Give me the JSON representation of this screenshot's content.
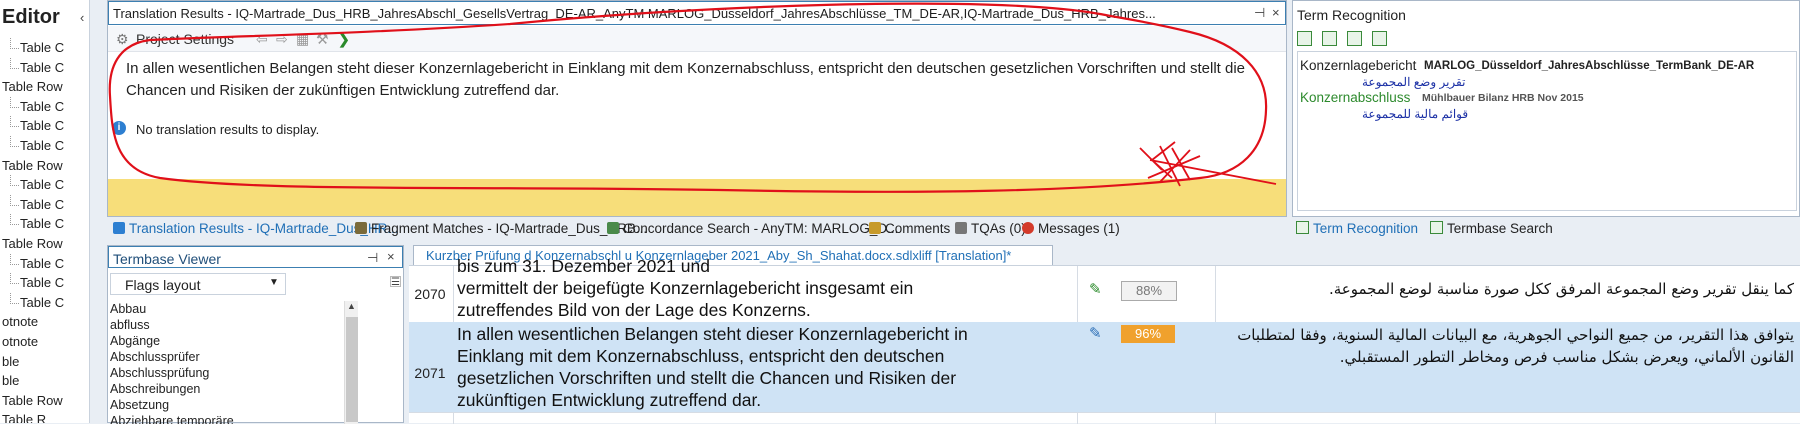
{
  "left_nav": {
    "title": "Editor",
    "collapse_glyph": "‹",
    "items": [
      {
        "label": "Table C",
        "indent": 2
      },
      {
        "label": "Table C",
        "indent": 2
      },
      {
        "label": "Table Row",
        "indent": 0
      },
      {
        "label": "Table C",
        "indent": 2
      },
      {
        "label": "Table C",
        "indent": 2
      },
      {
        "label": "Table C",
        "indent": 2
      },
      {
        "label": "Table Row",
        "indent": 0
      },
      {
        "label": "Table C",
        "indent": 2
      },
      {
        "label": "Table C",
        "indent": 2
      },
      {
        "label": "Table C",
        "indent": 2
      },
      {
        "label": "Table Row",
        "indent": 0
      },
      {
        "label": "Table C",
        "indent": 2
      },
      {
        "label": "Table C",
        "indent": 2
      },
      {
        "label": "Table C",
        "indent": 2
      },
      {
        "label": "otnote",
        "indent": 0
      },
      {
        "label": "otnote",
        "indent": 0
      },
      {
        "label": "ble",
        "indent": 0
      },
      {
        "label": "ble",
        "indent": 0
      },
      {
        "label": "Table Row",
        "indent": 0
      },
      {
        "label": "Table R",
        "indent": 0
      }
    ]
  },
  "translation_results": {
    "title": "Translation Results - IQ-Martrade_Dus_HRB_JahresAbschl_GesellsVertrag_DE-AR_AnyTM  MARLOG_Düsseldorf_JahresAbschlüsse_TM_DE-AR,IQ-Martrade_Dus_HRB_Jahres...",
    "pin_glyph": "⊣",
    "close_glyph": "×",
    "project_settings": "Project Settings",
    "source_text": "In allen wesentlichen Belangen steht dieser Konzernlagebericht in Einklang mit dem Konzernabschluss, entspricht den deutschen gesetzlichen Vorschriften und stellt die Chancen und Risiken der zukünftigen Entwicklung zutreffend dar.",
    "no_results": "No translation results to display.",
    "info_glyph": "i"
  },
  "bottom_tabs": [
    {
      "label": "Translation Results - IQ-Martrade_Dus_HR...",
      "active": true,
      "icon_color": "#2d7fd1"
    },
    {
      "label": "Fragment Matches - IQ-Martrade_Dus_HRB...",
      "active": false,
      "icon_color": "#7a6a3a"
    },
    {
      "label": "Concordance Search - AnyTM: MARLOG_D...",
      "active": false,
      "icon_color": "#4a8a4a"
    },
    {
      "label": "Comments",
      "active": false,
      "icon_color": "#c79a2a"
    },
    {
      "label": "TQAs (0)",
      "active": false,
      "icon_color": "#777777"
    },
    {
      "label": "Messages (1)",
      "active": false,
      "icon_color": "#d33a2a"
    }
  ],
  "term_recognition": {
    "title": "Term Recognition",
    "terms": [
      {
        "source": "Konzernlagebericht",
        "target": "تقرير وضع المجموعة",
        "termbase": "MARLOG_Düsseldorf_JahresAbschlüsse_TermBank_DE-AR",
        "color": "#222222"
      },
      {
        "source": "Konzernabschluss",
        "target": "قوائم مالية للمجموعة",
        "termbase": "Mühlbauer Bilanz HRB Nov 2015",
        "color": "#2d8a2d"
      }
    ],
    "tabs": [
      {
        "label": "Term Recognition",
        "active": true
      },
      {
        "label": "Termbase Search",
        "active": false
      }
    ]
  },
  "termbase_viewer": {
    "title": "Termbase Viewer",
    "pin_glyph": "⊣",
    "close_glyph": "×",
    "layout_select": "Flags layout",
    "items": [
      "Abbau",
      "abfluss",
      "Abgänge",
      "Abschlussprüfer",
      "Abschlussprüfung",
      "Abschreibungen",
      "Absetzung",
      "Abziehbare temporäre"
    ]
  },
  "editor": {
    "tab_title": "Kurzber Prüfung d Konzernabschl u Konzernlageber 2021_Aby_Sh_Shahat.docx.sdlxliff [Translation]*",
    "segments": [
      {
        "number": "2070",
        "source_lines": [
          "bis zum 31. Dezember 2021 und",
          "vermittelt der beigefügte Konzernlagebericht insgesamt ein",
          "zutreffendes Bild von der Lage des Konzerns."
        ],
        "match": "88%",
        "match_style": "fuzzy-grey",
        "target": "كما ينقل تقرير وضع المجموعة المرفق ككل صورة مناسبة لوضع المجموعة.",
        "active": false
      },
      {
        "number": "2071",
        "source_lines": [
          "In allen wesentlichen Belangen steht dieser Konzernlagebericht in",
          "Einklang mit dem Konzernabschluss, entspricht den deutschen",
          "gesetzlichen Vorschriften und stellt die Chancen und Risiken der",
          "zukünftigen Entwicklung zutreffend dar."
        ],
        "match": "96%",
        "match_style": "fuzzy-orange",
        "target": "يتوافق هذا التقرير، من جميع النواحي الجوهرية، مع البيانات المالية السنوية، وفقا لمتطلبات القانون الألماني، ويعرض بشكل مناسب فرص ومخاطر التطور المستقبلي.",
        "active": true
      }
    ]
  },
  "colors": {
    "active_row": "#cfe3f5",
    "yellow_bar": "#f7de7a",
    "match_orange": "#f0a12d",
    "scribble_red": "#e0101a"
  }
}
